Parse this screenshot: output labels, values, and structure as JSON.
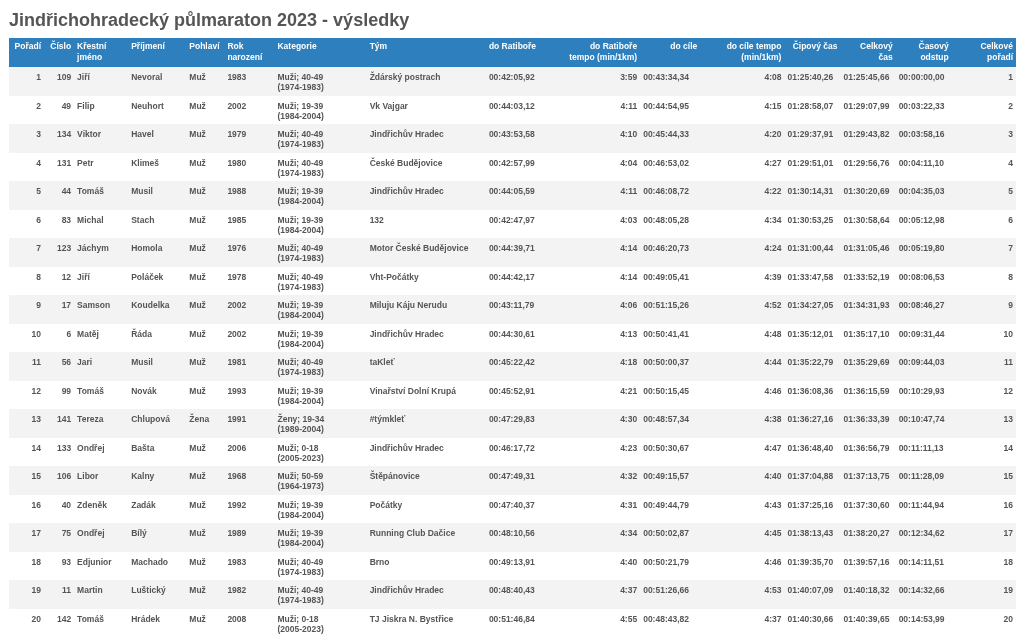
{
  "title": "Jindřichohradecký půlmaraton 2023 - výsledky",
  "columns": [
    {
      "label": "Pořadí",
      "kind": "number"
    },
    {
      "label": "Číslo",
      "kind": "number"
    },
    {
      "label": "Křestní jméno",
      "kind": "text"
    },
    {
      "label": "Příjmení",
      "kind": "text"
    },
    {
      "label": "Pohlaví",
      "kind": "text"
    },
    {
      "label": "Rok narození",
      "kind": "text"
    },
    {
      "label": "Kategorie",
      "kind": "text"
    },
    {
      "label": "Tým",
      "kind": "text"
    },
    {
      "label": "do Ratiboře",
      "kind": "time_left"
    },
    {
      "label": "do Ratiboře tempo (min/1km)",
      "kind": "number"
    },
    {
      "label": "do cíle",
      "kind": "time"
    },
    {
      "label": "do cíle tempo (min/1km)",
      "kind": "number"
    },
    {
      "label": "Čipový čas",
      "kind": "time"
    },
    {
      "label": "Celkový čas",
      "kind": "time"
    },
    {
      "label": "Časový odstup",
      "kind": "time"
    },
    {
      "label": "Celkové pořadí",
      "kind": "number"
    }
  ],
  "rows": [
    [
      "1",
      "109",
      "Jiří",
      "Nevoral",
      "Muž",
      "1983",
      "Muži; 40-49 (1974-1983)",
      "Ždárský postrach",
      "00:42:05,92",
      "3:59",
      "00:43:34,34",
      "4:08",
      "01:25:40,26",
      "01:25:45,66",
      "00:00:00,00",
      "1"
    ],
    [
      "2",
      "49",
      "Filip",
      "Neuhort",
      "Muž",
      "2002",
      "Muži; 19-39 (1984-2004)",
      "Vk Vajgar",
      "00:44:03,12",
      "4:11",
      "00:44:54,95",
      "4:15",
      "01:28:58,07",
      "01:29:07,99",
      "00:03:22,33",
      "2"
    ],
    [
      "3",
      "134",
      "Viktor",
      "Havel",
      "Muž",
      "1979",
      "Muži; 40-49 (1974-1983)",
      "Jindřichův Hradec",
      "00:43:53,58",
      "4:10",
      "00:45:44,33",
      "4:20",
      "01:29:37,91",
      "01:29:43,82",
      "00:03:58,16",
      "3"
    ],
    [
      "4",
      "131",
      "Petr",
      "Klimeš",
      "Muž",
      "1980",
      "Muži; 40-49 (1974-1983)",
      "České Budějovice",
      "00:42:57,99",
      "4:04",
      "00:46:53,02",
      "4:27",
      "01:29:51,01",
      "01:29:56,76",
      "00:04:11,10",
      "4"
    ],
    [
      "5",
      "44",
      "Tomáš",
      "Musil",
      "Muž",
      "1988",
      "Muži; 19-39 (1984-2004)",
      "Jindřichův Hradec",
      "00:44:05,59",
      "4:11",
      "00:46:08,72",
      "4:22",
      "01:30:14,31",
      "01:30:20,69",
      "00:04:35,03",
      "5"
    ],
    [
      "6",
      "83",
      "Michal",
      "Stach",
      "Muž",
      "1985",
      "Muži; 19-39 (1984-2004)",
      "132",
      "00:42:47,97",
      "4:03",
      "00:48:05,28",
      "4:34",
      "01:30:53,25",
      "01:30:58,64",
      "00:05:12,98",
      "6"
    ],
    [
      "7",
      "123",
      "Jáchym",
      "Homola",
      "Muž",
      "1976",
      "Muži; 40-49 (1974-1983)",
      "Motor České Budějovice",
      "00:44:39,71",
      "4:14",
      "00:46:20,73",
      "4:24",
      "01:31:00,44",
      "01:31:05,46",
      "00:05:19,80",
      "7"
    ],
    [
      "8",
      "12",
      "Jiří",
      "Poláček",
      "Muž",
      "1978",
      "Muži; 40-49 (1974-1983)",
      "Vht-Počátky",
      "00:44:42,17",
      "4:14",
      "00:49:05,41",
      "4:39",
      "01:33:47,58",
      "01:33:52,19",
      "00:08:06,53",
      "8"
    ],
    [
      "9",
      "17",
      "Samson",
      "Koudelka",
      "Muž",
      "2002",
      "Muži; 19-39 (1984-2004)",
      "Miluju Káju Nerudu",
      "00:43:11,79",
      "4:06",
      "00:51:15,26",
      "4:52",
      "01:34:27,05",
      "01:34:31,93",
      "00:08:46,27",
      "9"
    ],
    [
      "10",
      "6",
      "Matěj",
      "Řáda",
      "Muž",
      "2002",
      "Muži; 19-39 (1984-2004)",
      "Jindřichův Hradec",
      "00:44:30,61",
      "4:13",
      "00:50:41,41",
      "4:48",
      "01:35:12,01",
      "01:35:17,10",
      "00:09:31,44",
      "10"
    ],
    [
      "11",
      "56",
      "Jari",
      "Musil",
      "Muž",
      "1981",
      "Muži; 40-49 (1974-1983)",
      "taKleť",
      "00:45:22,42",
      "4:18",
      "00:50:00,37",
      "4:44",
      "01:35:22,79",
      "01:35:29,69",
      "00:09:44,03",
      "11"
    ],
    [
      "12",
      "99",
      "Tomáš",
      "Novák",
      "Muž",
      "1993",
      "Muži; 19-39 (1984-2004)",
      "Vinařství Dolní Krupá",
      "00:45:52,91",
      "4:21",
      "00:50:15,45",
      "4:46",
      "01:36:08,36",
      "01:36:15,59",
      "00:10:29,93",
      "12"
    ],
    [
      "13",
      "141",
      "Tereza",
      "Chlupová",
      "Žena",
      "1991",
      "Ženy; 19-34 (1989-2004)",
      "#týmkleť",
      "00:47:29,83",
      "4:30",
      "00:48:57,34",
      "4:38",
      "01:36:27,16",
      "01:36:33,39",
      "00:10:47,74",
      "13"
    ],
    [
      "14",
      "133",
      "Ondřej",
      "Bašta",
      "Muž",
      "2006",
      "Muži; 0-18 (2005-2023)",
      "Jindřichův Hradec",
      "00:46:17,72",
      "4:23",
      "00:50:30,67",
      "4:47",
      "01:36:48,40",
      "01:36:56,79",
      "00:11:11,13",
      "14"
    ],
    [
      "15",
      "106",
      "Libor",
      "Kalny",
      "Muž",
      "1968",
      "Muži; 50-59 (1964-1973)",
      "Štěpánovice",
      "00:47:49,31",
      "4:32",
      "00:49:15,57",
      "4:40",
      "01:37:04,88",
      "01:37:13,75",
      "00:11:28,09",
      "15"
    ],
    [
      "16",
      "40",
      "Zdeněk",
      "Zadák",
      "Muž",
      "1992",
      "Muži; 19-39 (1984-2004)",
      "Počátky",
      "00:47:40,37",
      "4:31",
      "00:49:44,79",
      "4:43",
      "01:37:25,16",
      "01:37:30,60",
      "00:11:44,94",
      "16"
    ],
    [
      "17",
      "75",
      "Ondřej",
      "Bílý",
      "Muž",
      "1989",
      "Muži; 19-39 (1984-2004)",
      "Running Club Dačice",
      "00:48:10,56",
      "4:34",
      "00:50:02,87",
      "4:45",
      "01:38:13,43",
      "01:38:20,27",
      "00:12:34,62",
      "17"
    ],
    [
      "18",
      "93",
      "Edjunior",
      "Machado",
      "Muž",
      "1983",
      "Muži; 40-49 (1974-1983)",
      "Brno",
      "00:49:13,91",
      "4:40",
      "00:50:21,79",
      "4:46",
      "01:39:35,70",
      "01:39:57,16",
      "00:14:11,51",
      "18"
    ],
    [
      "19",
      "11",
      "Martin",
      "Luštický",
      "Muž",
      "1982",
      "Muži; 40-49 (1974-1983)",
      "Jindřichův Hradec",
      "00:48:40,43",
      "4:37",
      "00:51:26,66",
      "4:53",
      "01:40:07,09",
      "01:40:18,32",
      "00:14:32,66",
      "19"
    ],
    [
      "20",
      "142",
      "Tomáš",
      "Hrádek",
      "Muž",
      "2008",
      "Muži; 0-18 (2005-2023)",
      "TJ Jiskra N. Bystřice",
      "00:51:46,84",
      "4:55",
      "00:48:43,82",
      "4:37",
      "01:40:30,66",
      "01:40:39,65",
      "00:14:53,99",
      "20"
    ]
  ]
}
